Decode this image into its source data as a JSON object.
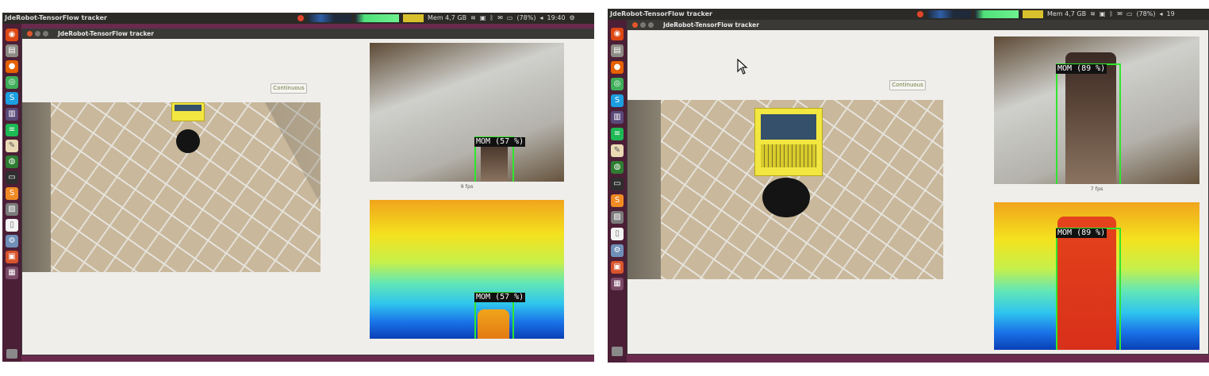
{
  "left": {
    "topbar": {
      "app_title": "JdeRobot-TensorFlow tracker",
      "mem": "Mem 4,7 GB",
      "battery": "(78%)",
      "clock": "19:40"
    },
    "window": {
      "title": "JdeRobot-TensorFlow tracker"
    },
    "continuous_button": "Continuous",
    "fps": "9 fps",
    "rgb_detection": {
      "label": "MOM (57 %)"
    },
    "depth_detection": {
      "label": "MOM (57 %)"
    }
  },
  "right": {
    "topbar": {
      "app_title": "JdeRobot-TensorFlow tracker",
      "mem": "Mem 4,7 GB",
      "battery": "(78%)",
      "clock": "19"
    },
    "window": {
      "title": "JdeRobot-TensorFlow tracker"
    },
    "continuous_button": "Continuous",
    "fps": "7 fps",
    "rgb_detection": {
      "label": "MOM (89 %)"
    },
    "depth_detection": {
      "label": "MOM (89 %)"
    }
  },
  "colors": {
    "detection_box": "#2ee62e",
    "launcher": "#4b1f36",
    "desktop": "#6a2a4e",
    "window_bg": "#efeeeb"
  },
  "launcher_icons": [
    "ubuntu-icon",
    "files-icon",
    "firefox-icon",
    "chrome-icon",
    "skype-icon",
    "rosbag-icon",
    "spotify-icon",
    "text-editor-icon",
    "globe-icon",
    "terminal-icon",
    "sublime-icon",
    "image-viewer-icon",
    "document-icon",
    "settings-icon",
    "software-icon",
    "workspace-icon",
    "trash-icon"
  ]
}
